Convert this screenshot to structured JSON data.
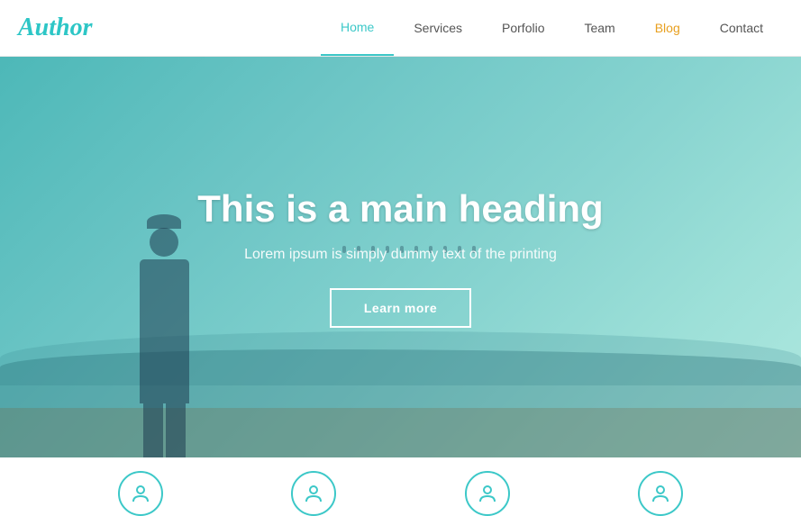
{
  "brand": {
    "name": "Author"
  },
  "nav": {
    "items": [
      {
        "id": "home",
        "label": "Home",
        "active": true
      },
      {
        "id": "services",
        "label": "Services",
        "active": false
      },
      {
        "id": "portfolio",
        "label": "Porfolio",
        "active": false
      },
      {
        "id": "team",
        "label": "Team",
        "active": false
      },
      {
        "id": "blog",
        "label": "Blog",
        "active": false,
        "special": "blog"
      },
      {
        "id": "contact",
        "label": "Contact",
        "active": false
      }
    ]
  },
  "hero": {
    "heading": "This is a main heading",
    "subtext": "Lorem ipsum is simply dummy text of the printing",
    "button_label": "Learn more"
  },
  "bottom": {
    "icons": [
      "icon1",
      "icon2",
      "icon3",
      "icon4"
    ]
  },
  "colors": {
    "brand": "#2dc6c6",
    "nav_active": "#3cc8c8",
    "blog_color": "#e8a020"
  }
}
